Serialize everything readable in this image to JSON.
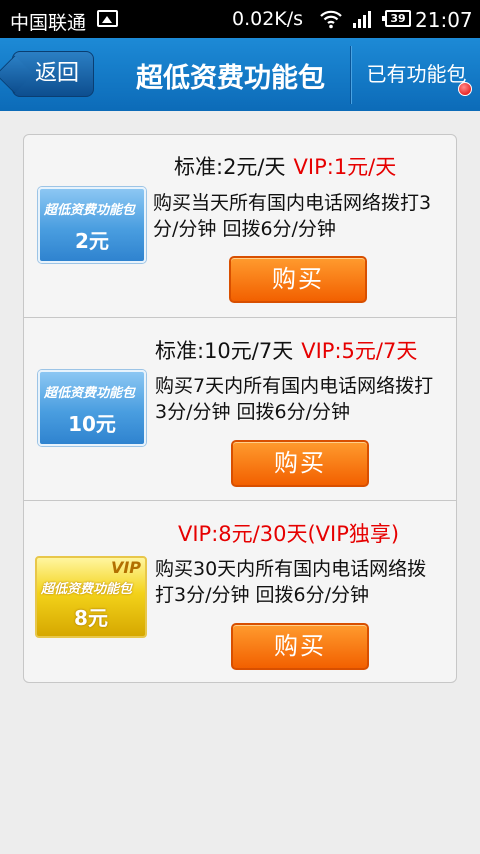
{
  "status_bar": {
    "carrier": "中国联通",
    "speed": "0.02K/s",
    "battery": "39",
    "time": "21:07"
  },
  "header": {
    "back_label": "返回",
    "title": "超低资费功能包",
    "owned_label": "已有功能包"
  },
  "packages": [
    {
      "price_standard": "标准:2元/天",
      "price_vip": "VIP:1元/天",
      "desc": "购买当天所有国内电话网络拨打3分/分钟 回拨6分/分钟",
      "card_title": "超低资费功能包",
      "card_value": "2元",
      "buy_label": "购买"
    },
    {
      "price_standard": "标准:10元/7天",
      "price_vip": "VIP:5元/7天",
      "desc": "购买7天内所有国内电话网络拨打3分/分钟 回拨6分/分钟",
      "card_title": "超低资费功能包",
      "card_value": "10元",
      "buy_label": "购买"
    },
    {
      "price_vip": "VIP:8元/30天(VIP独享)",
      "desc": "购买30天内所有国内电话网络拨打3分/分钟 回拨6分/分钟",
      "card_title": "超低资费功能包",
      "card_value": "8元",
      "card_badge": "VIP",
      "buy_label": "购买"
    }
  ],
  "colors": {
    "header_blue": "#1d8ad6",
    "vip_red": "#e60000",
    "buy_orange": "#f26000"
  }
}
